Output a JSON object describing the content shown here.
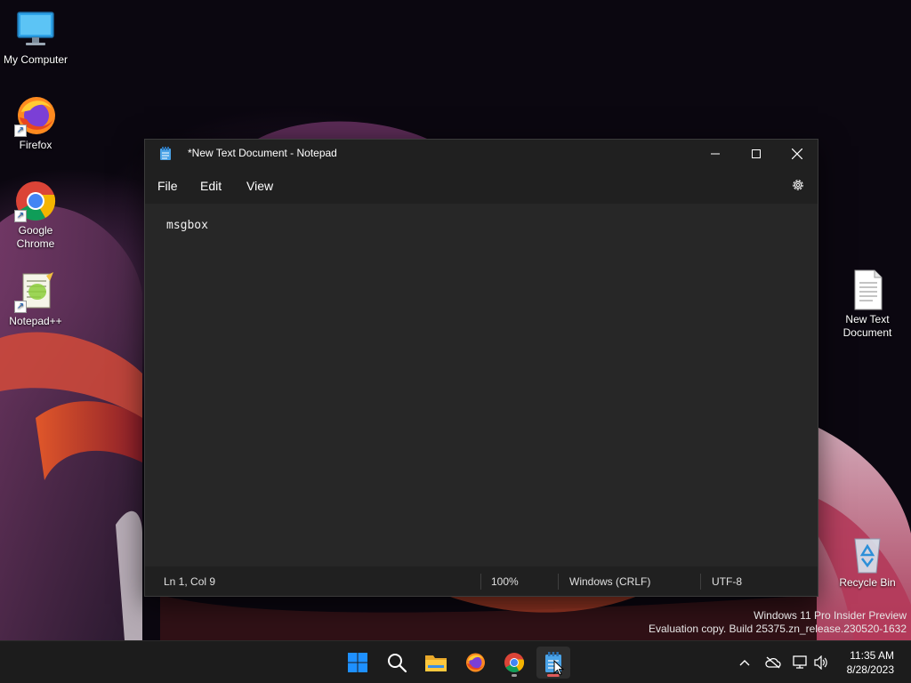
{
  "desktop": {
    "icons": [
      {
        "label": "My Computer"
      },
      {
        "label": "Firefox"
      },
      {
        "label": "Google Chrome"
      },
      {
        "label": "Notepad++"
      },
      {
        "label": "New Text Document"
      },
      {
        "label": "Recycle Bin"
      }
    ]
  },
  "window": {
    "title": "*New Text Document - Notepad",
    "menu": [
      "File",
      "Edit",
      "View"
    ],
    "content": "msgbox",
    "status": {
      "position": "Ln 1, Col 9",
      "zoom": "100%",
      "line_ending": "Windows (CRLF)",
      "encoding": "UTF-8"
    }
  },
  "watermark": {
    "line1": "Windows 11 Pro Insider Preview",
    "line2": "Evaluation copy. Build 25375.zn_release.230520-1632"
  },
  "taskbar": {
    "apps": [
      "start-icon",
      "search-icon",
      "file-explorer-icon",
      "firefox-icon",
      "chrome-icon",
      "notepad-icon"
    ],
    "clock": {
      "time": "11:35 AM",
      "date": "8/28/2023"
    }
  },
  "colors": {
    "window_bg": "#202020",
    "editor_bg": "#272727",
    "taskbar_bg": "#1c1c1c",
    "accent": "#0078d4"
  }
}
